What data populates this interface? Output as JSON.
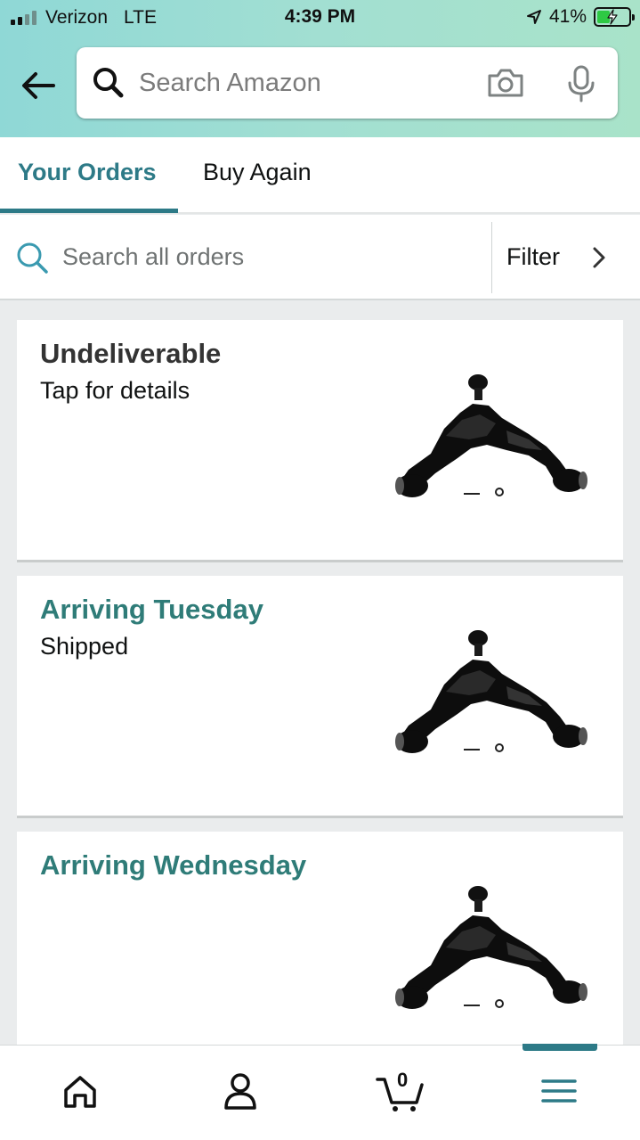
{
  "status_bar": {
    "carrier": "Verizon",
    "network": "LTE",
    "time": "4:39 PM",
    "battery": "41%",
    "battery_level": 0.41
  },
  "search": {
    "placeholder": "Search Amazon"
  },
  "tabs": [
    {
      "label": "Your Orders",
      "active": true
    },
    {
      "label": "Buy Again",
      "active": false
    }
  ],
  "order_search": {
    "placeholder": "Search all orders",
    "filter_label": "Filter"
  },
  "orders": [
    {
      "status": "Undeliverable",
      "detail": "Tap for details",
      "image": "control-arm-image"
    },
    {
      "status": "Arriving Tuesday",
      "detail": "Shipped",
      "image": "control-arm-image"
    },
    {
      "status": "Arriving Wednesday",
      "detail": "",
      "image": "control-arm-image"
    }
  ],
  "bottom_nav": {
    "items": [
      "home-icon",
      "account-icon",
      "cart-icon",
      "menu-icon"
    ],
    "cart_count": "0",
    "active": "menu-icon"
  },
  "colors": {
    "accent": "#2d7a87",
    "arriving": "#2f7c78",
    "header_gradient_start": "#8fd8d6",
    "header_gradient_end": "#a9e3c9"
  }
}
